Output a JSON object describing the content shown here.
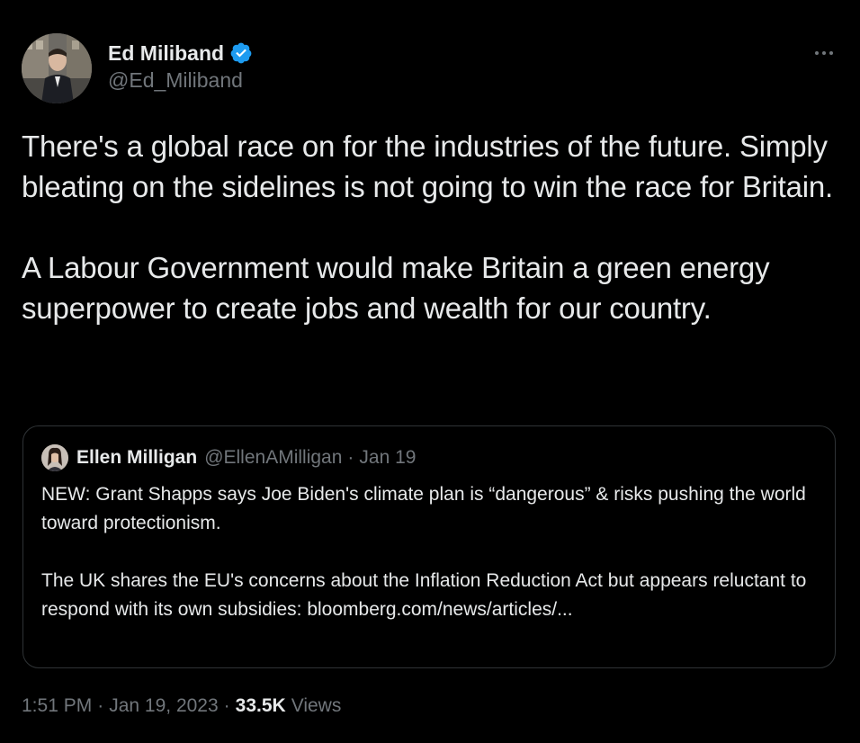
{
  "author": {
    "display_name": "Ed Miliband",
    "handle": "@Ed_Miliband",
    "verified_icon": "verified-badge-icon",
    "verified_color": "#1d9bf0"
  },
  "more_icon": "more-options-icon",
  "tweet": {
    "paragraphs": [
      "There's a global race on for the industries of the future. Simply bleating on the sidelines is not going to win the race for Britain.",
      "A Labour Government would make Britain a green energy superpower to create jobs and wealth for our country."
    ]
  },
  "quoted_tweet": {
    "display_name": "Ellen Milligan",
    "handle": "@EllenAMilligan",
    "separator": "·",
    "date": "Jan 19",
    "paragraphs": [
      "NEW: Grant Shapps says Joe Biden's climate plan is “dangerous” & risks pushing the world toward protectionism.",
      "The UK shares the EU's concerns about the Inflation Reduction Act but appears reluctant to respond with its own subsidies: bloomberg.com/news/articles/..."
    ]
  },
  "meta": {
    "time": "1:51 PM",
    "separator": "·",
    "date": "Jan 19, 2023",
    "views_count": "33.5K",
    "views_label": "Views"
  },
  "colors": {
    "background": "#000000",
    "text_primary": "#e7e9ea",
    "text_secondary": "#71767b",
    "border": "#2f3336",
    "accent": "#1d9bf0"
  }
}
